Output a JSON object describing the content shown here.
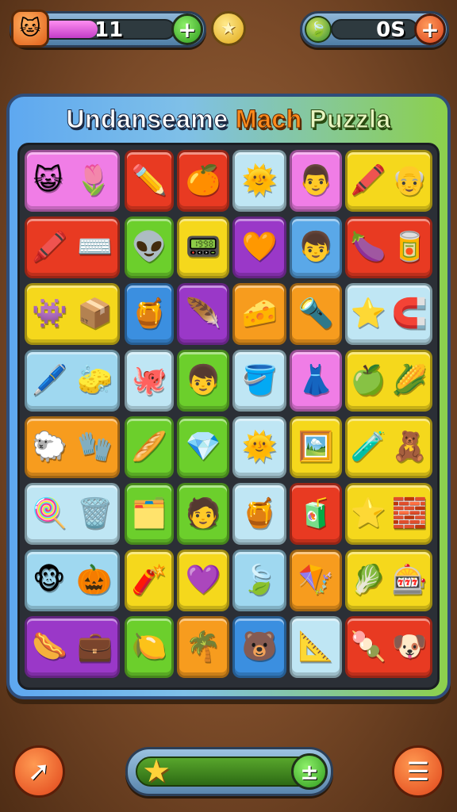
{
  "hud": {
    "left_counter": {
      "value": "11",
      "bar_fill_percent": 42,
      "icon": "cat-face-icon",
      "add_label": "+"
    },
    "center": {
      "icon": "star-coin-icon",
      "glyph": "★"
    },
    "right_counter": {
      "value": "0S",
      "icon": "leaf-gem-icon",
      "add_label": "+"
    }
  },
  "board": {
    "title_part1": "Undanseame",
    "title_part2": "Mach",
    "title_part3": "Puzzla",
    "rows": [
      [
        {
          "c": "#f07de6",
          "icons": [
            "😺",
            "🌷"
          ]
        },
        {
          "c": "#e83a22",
          "icons": [
            "✏️"
          ]
        },
        {
          "c": "#e83a22",
          "icons": [
            "🍊"
          ]
        },
        {
          "c": "#bfe6f4",
          "icons": [
            "🌞"
          ]
        },
        {
          "c": "#f07de6",
          "icons": [
            "👨"
          ]
        },
        {
          "c": "#f5d81c",
          "icons": [
            "🖍️",
            "👴"
          ]
        }
      ],
      [
        {
          "c": "#e83a22",
          "icons": [
            "🖍️",
            "⌨️"
          ]
        },
        {
          "c": "#6ccf2c",
          "icons": [
            "👽"
          ]
        },
        {
          "c": "#f5d81c",
          "icons": [
            "📟"
          ]
        },
        {
          "c": "#9a38c8",
          "icons": [
            "🧡"
          ]
        },
        {
          "c": "#5aa8e8",
          "icons": [
            "👦"
          ]
        },
        {
          "c": "#e83a22",
          "icons": [
            "🍆",
            "🥫"
          ]
        }
      ],
      [
        {
          "c": "#f5d81c",
          "icons": [
            "👾",
            "📦"
          ]
        },
        {
          "c": "#3b8fe0",
          "icons": [
            "🍯"
          ]
        },
        {
          "c": "#9a38c8",
          "icons": [
            "🪶"
          ]
        },
        {
          "c": "#f79c1e",
          "icons": [
            "🧀"
          ]
        },
        {
          "c": "#f79c1e",
          "icons": [
            "🔦"
          ]
        },
        {
          "c": "#bfe6f4",
          "icons": [
            "⭐",
            "🧲"
          ]
        }
      ],
      [
        {
          "c": "#9fd8f0",
          "icons": [
            "🖊️",
            "🧽"
          ]
        },
        {
          "c": "#bfe6f4",
          "icons": [
            "🐙"
          ]
        },
        {
          "c": "#6ccf2c",
          "icons": [
            "👦"
          ]
        },
        {
          "c": "#bfe6f4",
          "icons": [
            "🪣"
          ]
        },
        {
          "c": "#f07de6",
          "icons": [
            "👗"
          ]
        },
        {
          "c": "#f5d81c",
          "icons": [
            "🍏",
            "🌽"
          ]
        }
      ],
      [
        {
          "c": "#f79c1e",
          "icons": [
            "🐑",
            "🧤"
          ]
        },
        {
          "c": "#6ccf2c",
          "icons": [
            "🥖"
          ]
        },
        {
          "c": "#6ccf2c",
          "icons": [
            "💎"
          ]
        },
        {
          "c": "#bfe6f4",
          "icons": [
            "🌞"
          ]
        },
        {
          "c": "#f5d81c",
          "icons": [
            "🖼️"
          ]
        },
        {
          "c": "#f5d81c",
          "icons": [
            "🧪",
            "🧸"
          ]
        }
      ],
      [
        {
          "c": "#bfe6f4",
          "icons": [
            "🍭",
            "🗑️"
          ]
        },
        {
          "c": "#6ccf2c",
          "icons": [
            "🗂️"
          ]
        },
        {
          "c": "#6ccf2c",
          "icons": [
            "🧑"
          ]
        },
        {
          "c": "#bfe6f4",
          "icons": [
            "🍯"
          ]
        },
        {
          "c": "#e83a22",
          "icons": [
            "🧃"
          ]
        },
        {
          "c": "#f5d81c",
          "icons": [
            "⭐",
            "🧱"
          ]
        }
      ],
      [
        {
          "c": "#9fd8f0",
          "icons": [
            "🐵",
            "🎃"
          ]
        },
        {
          "c": "#f5d81c",
          "icons": [
            "🧨"
          ]
        },
        {
          "c": "#f5d81c",
          "icons": [
            "💜"
          ]
        },
        {
          "c": "#9fd8f0",
          "icons": [
            "🍃"
          ]
        },
        {
          "c": "#f79c1e",
          "icons": [
            "🪁"
          ]
        },
        {
          "c": "#f5d81c",
          "icons": [
            "🥬",
            "🎰"
          ]
        }
      ],
      [
        {
          "c": "#9a38c8",
          "icons": [
            "🌭",
            "💼"
          ]
        },
        {
          "c": "#6ccf2c",
          "icons": [
            "🍋"
          ]
        },
        {
          "c": "#f79c1e",
          "icons": [
            "🌴"
          ]
        },
        {
          "c": "#3b8fe0",
          "icons": [
            "🐻"
          ]
        },
        {
          "c": "#bfe6f4",
          "icons": [
            "📐"
          ]
        },
        {
          "c": "#e83a22",
          "icons": [
            "🍡",
            "🐶"
          ]
        }
      ]
    ]
  },
  "bottom": {
    "left_button": {
      "icon": "cursor-pointer-icon",
      "glyph": "➚"
    },
    "center_bar": {
      "icon": "star-icon",
      "glyph": "★",
      "action_glyph": "±"
    },
    "right_button": {
      "icon": "menu-list-icon",
      "glyph": "☰"
    }
  }
}
